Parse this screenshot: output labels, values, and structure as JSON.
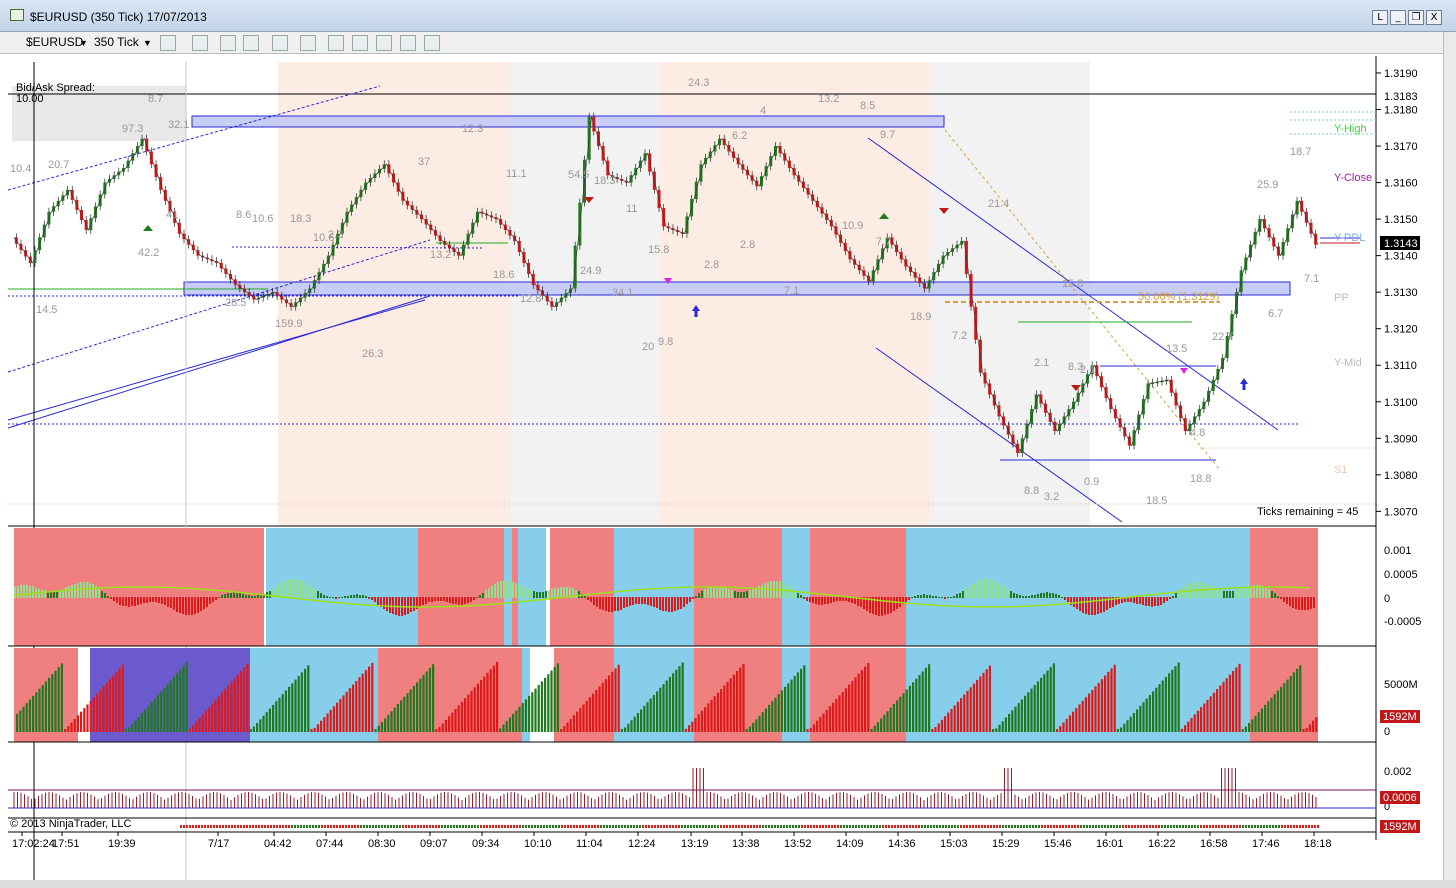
{
  "window": {
    "title": "$EURUSD (350 Tick)  17/07/2013",
    "buttons": [
      "L",
      "_",
      "❐",
      "X"
    ]
  },
  "toolbar": {
    "instrument": "$EURUSD",
    "interval": "350 Tick",
    "icons": [
      "bar-style-icon",
      "draw-pencil-icon",
      "crosshair-icon",
      "zoom-icon",
      "indicators-icon",
      "strategies-icon",
      "properties-icon",
      "data-box-icon"
    ]
  },
  "colors": {
    "up_candle": "#1f7a1f",
    "down_candle": "#d11818",
    "bg_red": "#f08080",
    "bg_blue": "#87ceeb",
    "bg_purple": "#6a5acd",
    "zone_blue": "#c8cdf5",
    "trendline": "#2a2ad8"
  },
  "chart_data": {
    "type": "line",
    "title": "",
    "y_axis": {
      "ticks": [
        "1.3190",
        "1.3180",
        "1.3170",
        "1.3160",
        "1.3150",
        "1.3140",
        "1.3130",
        "1.3120",
        "1.3110",
        "1.3100",
        "1.3090",
        "1.3080",
        "1.3070"
      ],
      "ylim": [
        1.3066,
        1.3193
      ],
      "last_price": "1.3143",
      "marked_price": "1.3183"
    },
    "x_axis": {
      "labels": [
        "17:02:24",
        "17:51",
        "19:39",
        "7/17",
        "04:42",
        "07:44",
        "08:30",
        "09:07",
        "09:34",
        "10:10",
        "11:04",
        "12:24",
        "13:19",
        "13:38",
        "13:52",
        "14:09",
        "14:36",
        "15:03",
        "15:29",
        "15:46",
        "16:01",
        "16:22",
        "16:58",
        "17:46",
        "18:18"
      ]
    },
    "series": [
      {
        "values": [
          1.3145,
          1.3138,
          1.3152,
          1.3158,
          1.3147,
          1.316,
          1.3164,
          1.3172,
          1.3158,
          1.3146,
          1.314,
          1.3138,
          1.3132,
          1.3128,
          1.313,
          1.3126,
          1.3131,
          1.314,
          1.3152,
          1.316,
          1.3165,
          1.3155,
          1.315,
          1.3144,
          1.314,
          1.3152,
          1.315,
          1.3144,
          1.3132,
          1.3126,
          1.3131,
          1.3178,
          1.3162,
          1.316,
          1.3168,
          1.3148,
          1.3146,
          1.3165,
          1.3172,
          1.3165,
          1.3159,
          1.317,
          1.3162,
          1.3155,
          1.3148,
          1.3139,
          1.3133,
          1.3145,
          1.3137,
          1.3131,
          1.314,
          1.3144,
          1.3108,
          1.3096,
          1.3086,
          1.3102,
          1.3092,
          1.31,
          1.311,
          1.3098,
          1.3088,
          1.3105,
          1.3106,
          1.3092,
          1.31,
          1.3112,
          1.3136,
          1.315,
          1.314,
          1.3155,
          1.3143
        ]
      }
    ],
    "annotations": {
      "line_labels": [
        "Y-High",
        "Y-Close",
        "Y-PDL",
        "PP",
        "Y-Mid",
        "S1"
      ],
      "fib_label": "50.00% (1.3129)",
      "bid_ask_label": "Bid/Ask Spread:",
      "bid_ask_value": "10.00",
      "ticks_remaining": "Ticks remaining = 45",
      "copyright": "© 2013 NinjaTrader, LLC",
      "swing_labels": [
        "10.4",
        "20.7",
        "97.3",
        "8.7",
        "32.1",
        "42.2",
        "41",
        "8.6",
        "10.6",
        "18.3",
        "2.3",
        "10.6",
        "28.5",
        "159.9",
        "14.5",
        "26.3",
        "12.3",
        "37",
        "13.2",
        "11.1",
        "18.6",
        "12.8",
        "54.5",
        "18.3",
        "11",
        "24.9",
        "34.1",
        "15.8",
        "20",
        "9.8",
        "2.8",
        "24.3",
        "4",
        "6.2",
        "2.8",
        "13.2",
        "8.5",
        "9.7",
        "10.9",
        "7.7",
        "7.1",
        "18.9",
        "7.2",
        "21.4",
        "2.1",
        "8.3",
        "2.1",
        "8.8",
        "3.2",
        "0.9",
        "15.8",
        "13.5",
        "22.7",
        "18.5",
        "18.8",
        "4.8",
        "25.9",
        "18.7",
        "6.7",
        "7.1"
      ]
    },
    "panels": [
      {
        "name": "oscillator",
        "ticks": [
          "0.001",
          "0.0005",
          "0",
          "-0.0005"
        ]
      },
      {
        "name": "volume",
        "ticks": [
          "5000M",
          "0"
        ],
        "last_value": "1592M"
      },
      {
        "name": "tick-indicator",
        "ticks": [
          "0.002",
          "0"
        ],
        "last_value": "0.0006"
      },
      {
        "name": "mini-volume",
        "last_value": "1592M"
      }
    ]
  }
}
